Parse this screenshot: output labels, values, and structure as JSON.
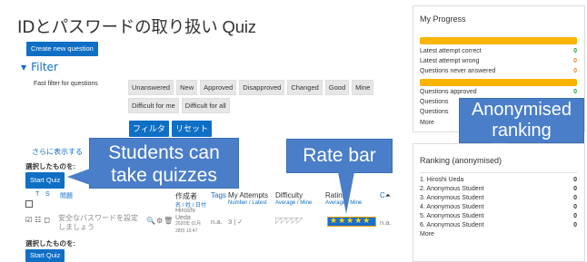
{
  "quiz": {
    "title_main": "IDとパスワードの取り扱い",
    "title_suffix": " Quiz",
    "gear_icon": "gear-icon",
    "create_button": "Create new question"
  },
  "filter": {
    "heading": "Filter",
    "fast_label": "Fast filter for questions",
    "chips_row1": [
      "Unanswered",
      "New",
      "Approved",
      "Disapproved",
      "Changed",
      "Good",
      "Mine"
    ],
    "chips_row2": [
      "Difficult for me",
      "Difficult for all"
    ],
    "apply_button": "フィルタ",
    "reset_button": "リセット",
    "show_more": "さらに表示する"
  },
  "selection": {
    "label": "選択したものを:",
    "start_quiz": "Start Quiz"
  },
  "table": {
    "col_t": "T",
    "col_s": "S",
    "col_question": "問題",
    "col_creator": "作成者",
    "col_creator_sub": "名 / 姓 / 日付",
    "col_tags": "Tags",
    "col_attempts": "My Attempts",
    "col_attempts_sub": "Number / Latest",
    "col_difficulty": "Difficulty",
    "col_difficulty_sub": "Average / Mine",
    "col_rating": "Rating",
    "col_rating_sub": "Average / Mine",
    "col_c": "C",
    "row": {
      "question": "安全なパスワードを設定しましょう",
      "question_line1": "安全なパスワードを設定",
      "question_line2": "しましょう",
      "creator_first": "Hiroshi",
      "creator_last": "Ueda",
      "date_line1": "2020年 01月",
      "date_line2": "28日 15:47",
      "tags": "n.a.",
      "attempts": "3 | ✓",
      "rating_average": "n.a.",
      "stars": "★★★★★"
    }
  },
  "callouts": {
    "students": "Students can take quizzes",
    "students_line1": "Students can",
    "students_line2": "take quizzes",
    "ratebar": "Rate bar",
    "anonymised": "Anonymised ranking",
    "anonymised_line1": "Anonymised",
    "anonymised_line2": "ranking"
  },
  "progress": {
    "title": "My Progress",
    "rows": [
      {
        "label": "Latest attempt correct",
        "value": "0",
        "color": "#2e9a2e"
      },
      {
        "label": "Latest attempt wrong",
        "value": "0",
        "color": "#f08030"
      },
      {
        "label": "Questions never answered",
        "value": "0",
        "color": "#f08030"
      }
    ],
    "rows2": [
      {
        "label": "Questions approved",
        "value": "0",
        "color": "#2e9a2e"
      },
      {
        "label": "Questions",
        "value": ""
      },
      {
        "label": "Questions",
        "value": ""
      }
    ],
    "more": "More"
  },
  "ranking": {
    "title": "Ranking (anonymised)",
    "rows": [
      {
        "label": "1. Hiroshi Ueda",
        "value": "0"
      },
      {
        "label": "2. Anonymous Student",
        "value": "0"
      },
      {
        "label": "3. Anonymous Student",
        "value": "0"
      },
      {
        "label": "4. Anonymous Student",
        "value": "0"
      },
      {
        "label": "5. Anonymous Student",
        "value": "0"
      },
      {
        "label": "6. Anonymous Student",
        "value": "0"
      }
    ],
    "more": "More"
  },
  "colors": {
    "brand_blue": "#0f6fc5",
    "callout_blue": "#4a7ec8",
    "bar_yellow": "#f9b404"
  }
}
